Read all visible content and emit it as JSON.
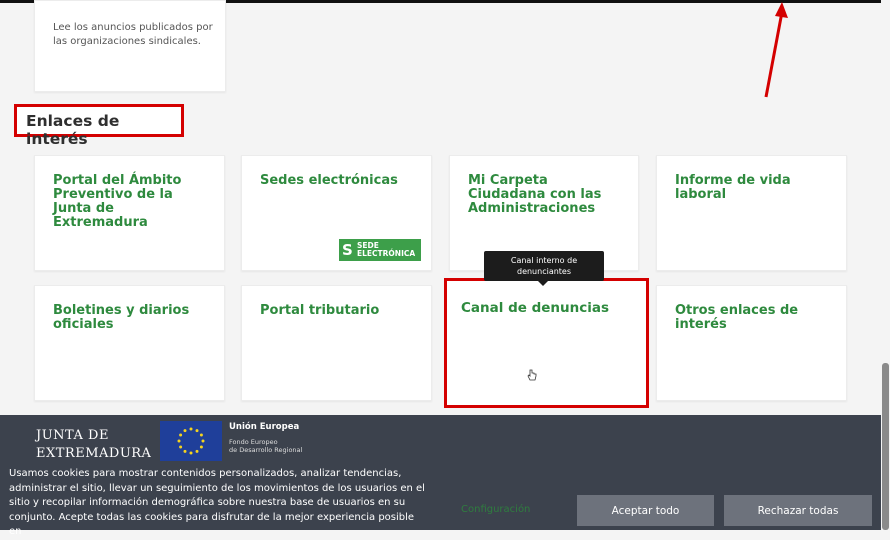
{
  "announcement_card": {
    "text": "Lee los anuncios publicados por las organizaciones sindicales."
  },
  "section": {
    "title": "Enlaces de interés"
  },
  "links": [
    {
      "label": "Portal del Ámbito Preventivo de la Junta de Extremadura"
    },
    {
      "label": "Sedes electrónicas",
      "badge": {
        "letter": "S",
        "line1": "SEDE",
        "line2": "ELECTRÓNICA"
      }
    },
    {
      "label": "Mi Carpeta Ciudadana con las Administraciones"
    },
    {
      "label": "Informe de vida laboral"
    },
    {
      "label": "Boletines y diarios oficiales"
    },
    {
      "label": "Portal tributario"
    },
    {
      "label": "Canal de denuncias",
      "tooltip": "Canal interno de denunciantes"
    },
    {
      "label": "Otros enlaces de interés"
    }
  ],
  "footer": {
    "logo_line1": "JUNTA DE",
    "logo_line2": "EXTREMADURA",
    "eu_title": "Unión Europea",
    "eu_sub1": "Fondo Europeo",
    "eu_sub2": "de Desarrollo Regional"
  },
  "cookie_banner": {
    "text": "Usamos cookies para mostrar contenidos personalizados, analizar tendencias, administrar el sitio, llevar un seguimiento de los movimientos de los usuarios en el sitio y recopilar información demográfica sobre nuestra base de usuarios en su conjunto. Acepte todas las cookies para disfrutar de la mejor experiencia posible en",
    "config_label": "Configuración",
    "accept_label": "Aceptar todo",
    "reject_label": "Rechazar todas"
  },
  "colors": {
    "link_green": "#2e8a3e",
    "highlight_red": "#d40000",
    "footer_bg": "#3c424d",
    "button_grey": "#6d727c"
  }
}
